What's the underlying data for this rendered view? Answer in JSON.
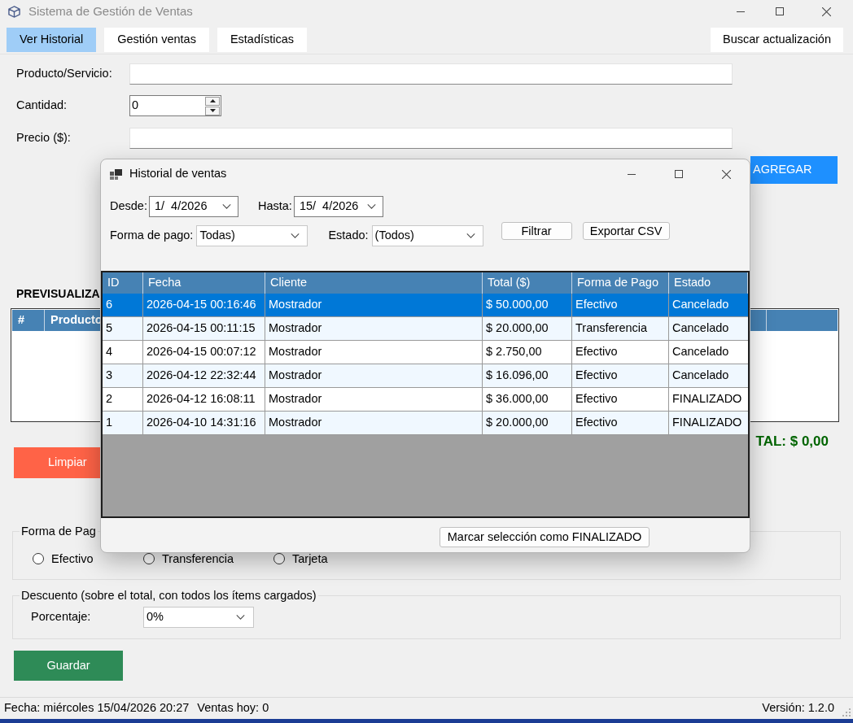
{
  "window": {
    "title": "Sistema de Gestión de Ventas"
  },
  "tabs": [
    {
      "label": "Ver Historial",
      "selected": true
    },
    {
      "label": "Gestión ventas",
      "selected": false
    },
    {
      "label": "Estadísticas",
      "selected": false
    }
  ],
  "update_button": "Buscar actualización",
  "form": {
    "fields": [
      {
        "kind": "text",
        "label": "Producto/Servicio:"
      },
      {
        "kind": "spinner",
        "label": "Cantidad:",
        "value": "0"
      },
      {
        "kind": "text",
        "label": "Precio ($):"
      }
    ],
    "add_button": "AGREGAR"
  },
  "preview": {
    "title": "PREVISUALIZA",
    "columns": [
      "#",
      "Producto"
    ],
    "total": "TAL: $ 0,00",
    "clear_button": "Limpiar"
  },
  "payment": {
    "title": "Forma de Pag",
    "options": [
      {
        "label": "Efectivo",
        "selected": false
      },
      {
        "label": "Transferencia",
        "selected": false
      },
      {
        "label": "Tarjeta",
        "selected": false
      }
    ]
  },
  "discount": {
    "title": "Descuento (sobre el total, con todos los ítems cargados)",
    "label": "Porcentaje:",
    "value": "0%"
  },
  "save_button": "Guardar",
  "status_bar": {
    "date": "Fecha: miércoles 15/04/2026 20:27",
    "sales_today": "Ventas hoy: 0",
    "version": "Versión: 1.2.0"
  },
  "dialog": {
    "title": "Historial de ventas",
    "date_filters": [
      {
        "label": "Desde:",
        "value": "1/  4/2026"
      },
      {
        "label": "Hasta:",
        "value": "15/  4/2026"
      }
    ],
    "dropdown_filters": [
      {
        "label": "Forma de pago:",
        "value": "Todas)"
      },
      {
        "label": "Estado:",
        "value": "(Todos)"
      }
    ],
    "buttons": [
      "Filtrar",
      "Exportar CSV"
    ],
    "table": {
      "columns": [
        "ID",
        "Fecha",
        "Cliente",
        "Total ($)",
        "Forma de Pago",
        "Estado"
      ],
      "rows": [
        {
          "cells": [
            "6",
            "2026-04-15 00:16:46",
            "Mostrador",
            "$ 50.000,00",
            "Efectivo",
            "Cancelado"
          ],
          "selected": true
        },
        {
          "cells": [
            "5",
            "2026-04-15 00:11:15",
            "Mostrador",
            "$ 20.000,00",
            "Transferencia",
            "Cancelado"
          ],
          "selected": false
        },
        {
          "cells": [
            "4",
            "2026-04-15 00:07:12",
            "Mostrador",
            "$ 2.750,00",
            "Efectivo",
            "Cancelado"
          ],
          "selected": false
        },
        {
          "cells": [
            "3",
            "2026-04-12 22:32:44",
            "Mostrador",
            "$ 16.096,00",
            "Efectivo",
            "Cancelado"
          ],
          "selected": false
        },
        {
          "cells": [
            "2",
            "2026-04-12 16:08:11",
            "Mostrador",
            "$ 36.000,00",
            "Efectivo",
            "FINALIZADO"
          ],
          "selected": false
        },
        {
          "cells": [
            "1",
            "2026-04-10 14:31:16",
            "Mostrador",
            "$ 20.000,00",
            "Efectivo",
            "FINALIZADO"
          ],
          "selected": false
        }
      ]
    },
    "mark_button": "Marcar selección como FINALIZADO"
  }
}
